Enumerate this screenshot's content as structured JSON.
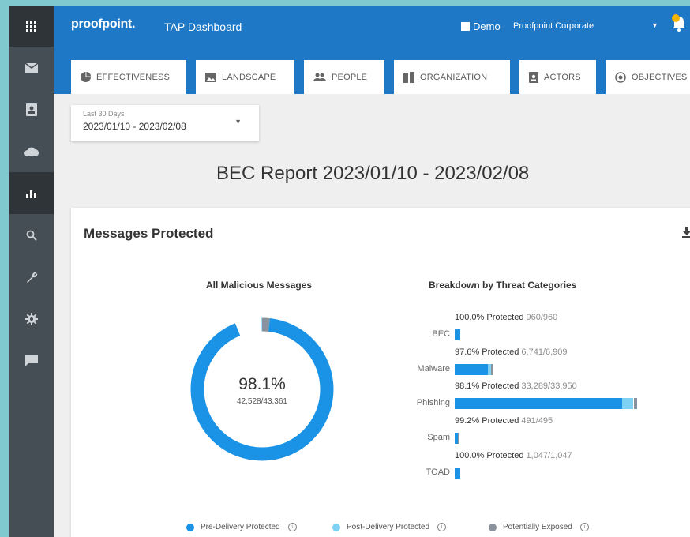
{
  "header": {
    "logo": "proofpoint.",
    "app_title": "TAP Dashboard",
    "demo_label": "Demo",
    "org": "Proofpoint Corporate"
  },
  "rail": {
    "icons": [
      "apps-grid-icon",
      "mail-icon",
      "contact-card-icon",
      "cloud-icon",
      "bar-chart-icon",
      "search-icon",
      "wrench-icon",
      "gear-icon",
      "message-icon"
    ],
    "active_index": 4
  },
  "tabs": [
    {
      "label": "EFFECTIVENESS",
      "icon": "pie-chart-icon"
    },
    {
      "label": "LANDSCAPE",
      "icon": "image-icon"
    },
    {
      "label": "PEOPLE",
      "icon": "people-icon"
    },
    {
      "label": "ORGANIZATION",
      "icon": "organization-icon"
    },
    {
      "label": "ACTORS",
      "icon": "badge-icon"
    },
    {
      "label": "OBJECTIVES",
      "icon": "target-icon"
    }
  ],
  "date_picker": {
    "label": "Last 30 Days",
    "value": "2023/01/10 - 2023/02/08"
  },
  "report_title": "BEC Report 2023/01/10 - 2023/02/08",
  "card": {
    "title": "Messages Protected",
    "donut_title": "All Malicious Messages",
    "breakdown_title": "Breakdown by Threat Categories",
    "donut_percent": "98.1%",
    "donut_count": "42,528/43,361"
  },
  "categories": [
    {
      "name": "BEC",
      "text": "100.0% Protected",
      "count": "960/960",
      "pre": 960,
      "post": 0,
      "exposed": 0
    },
    {
      "name": "Malware",
      "text": "97.6% Protected",
      "count": "6,741/6,909",
      "pre": 6240,
      "post": 501,
      "exposed": 168
    },
    {
      "name": "Phishing",
      "text": "98.1% Protected",
      "count": "33,289/33,950",
      "pre": 31180,
      "post": 2109,
      "exposed": 661
    },
    {
      "name": "Spam",
      "text": "99.2% Protected",
      "count": "491/495",
      "pre": 491,
      "post": 0,
      "exposed": 4
    },
    {
      "name": "TOAD",
      "text": "100.0% Protected",
      "count": "1,047/1,047",
      "pre": 1047,
      "post": 0,
      "exposed": 0
    }
  ],
  "legend": [
    {
      "label": "Pre-Delivery Protected",
      "color": "#1a93e6"
    },
    {
      "label": "Post-Delivery Protected",
      "color": "#7fd1f4"
    },
    {
      "label": "Potentially Exposed",
      "color": "#8a939b"
    }
  ],
  "chart_data": [
    {
      "type": "pie",
      "title": "All Malicious Messages",
      "labels": [
        "Pre-Delivery Protected",
        "Post-Delivery Protected",
        "Potentially Exposed"
      ],
      "values": [
        39918,
        2610,
        833
      ],
      "center_label": "98.1%",
      "center_sublabel": "42,528/43,361"
    },
    {
      "type": "bar",
      "orientation": "horizontal",
      "stacked": true,
      "title": "Breakdown by Threat Categories",
      "categories": [
        "BEC",
        "Malware",
        "Phishing",
        "Spam",
        "TOAD"
      ],
      "series": [
        {
          "name": "Pre-Delivery Protected",
          "values": [
            960,
            6240,
            31180,
            491,
            1047
          ]
        },
        {
          "name": "Post-Delivery Protected",
          "values": [
            0,
            501,
            2109,
            0,
            0
          ]
        },
        {
          "name": "Potentially Exposed",
          "values": [
            0,
            168,
            661,
            4,
            0
          ]
        }
      ]
    }
  ],
  "colors": {
    "brand": "#1f78c6",
    "rail": "#454d55",
    "pre_delivery": "#1a93e6",
    "post_delivery": "#7fd1f4",
    "exposed": "#8a939b"
  }
}
